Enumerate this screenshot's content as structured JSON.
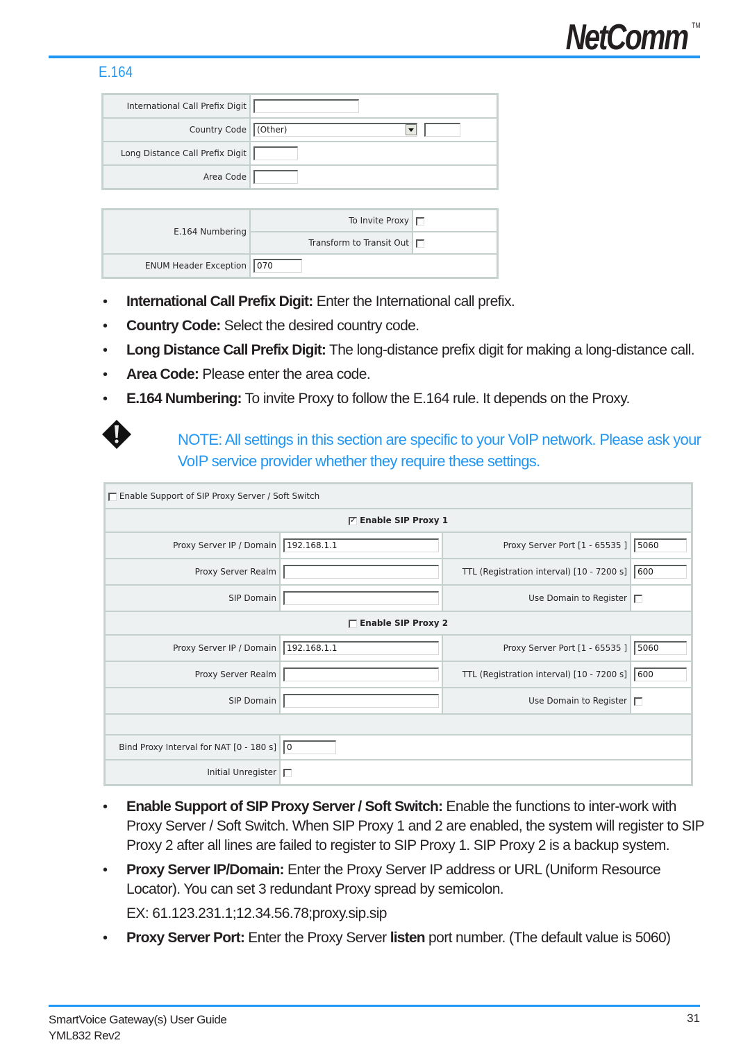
{
  "header": {
    "brand": "NetComm",
    "trademark": "TM",
    "section_title": "E.164",
    "accent_color": "#2196f3"
  },
  "e164_table": {
    "rows": [
      {
        "label": "International Call Prefix Digit",
        "value": ""
      },
      {
        "label": "Country Code",
        "select_value": "(Other)",
        "value": ""
      },
      {
        "label": "Long Distance Call Prefix Digit",
        "value": ""
      },
      {
        "label": "Area Code",
        "value": ""
      }
    ]
  },
  "e164_numbering_table": {
    "group_label": "E.164 Numbering",
    "options": [
      {
        "label": "To Invite Proxy",
        "checked": false
      },
      {
        "label": "Transform to Transit Out",
        "checked": false
      }
    ],
    "enum_label": "ENUM Header Exception",
    "enum_value": "070"
  },
  "bullets_1": [
    {
      "term": "International Call Prefix Digit:",
      "text": " Enter the International call prefix."
    },
    {
      "term": "Country Code:",
      "text": " Select the desired country code."
    },
    {
      "term": "Long Distance Call Prefix Digit:",
      "text": " The long-distance prefix digit for making a long-distance call."
    },
    {
      "term": "Area Code:",
      "text": " Please enter the area code."
    },
    {
      "term": "E.164 Numbering:",
      "text": " To invite Proxy to follow the E.164 rule. It depends on the Proxy."
    }
  ],
  "note": {
    "icon": "warning-diamond-icon",
    "text": "NOTE: All settings in this section are specific to your VoIP network. Please ask your VoIP service provider whether they require these settings."
  },
  "sip_table": {
    "enable_support_label": "Enable Support of SIP Proxy Server / Soft Switch",
    "enable_support_checked": false,
    "proxies": [
      {
        "enable_label": "Enable SIP Proxy 1",
        "enabled": true,
        "ip_label": "Proxy Server IP / Domain",
        "ip_value": "192.168.1.1",
        "port_label": "Proxy Server Port [1 - 65535 ]",
        "port_value": "5060",
        "realm_label": "Proxy Server Realm",
        "realm_value": "",
        "ttl_label": "TTL (Registration interval) [10 - 7200 s]",
        "ttl_value": "600",
        "domain_label": "SIP Domain",
        "domain_value": "",
        "use_domain_label": "Use Domain to Register",
        "use_domain_checked": false
      },
      {
        "enable_label": "Enable SIP Proxy 2",
        "enabled": false,
        "ip_label": "Proxy Server IP / Domain",
        "ip_value": "192.168.1.1",
        "port_label": "Proxy Server Port [1 - 65535 ]",
        "port_value": "5060",
        "realm_label": "Proxy Server Realm",
        "realm_value": "",
        "ttl_label": "TTL (Registration interval) [10 - 7200 s]",
        "ttl_value": "600",
        "domain_label": "SIP Domain",
        "domain_value": "",
        "use_domain_label": "Use Domain to Register",
        "use_domain_checked": false
      }
    ],
    "bind_label": "Bind Proxy Interval for NAT [0 - 180 s]",
    "bind_value": "0",
    "unregister_label": "Initial Unregister",
    "unregister_checked": false
  },
  "bullets_2": [
    {
      "term": "Enable Support of SIP Proxy Server / Soft Switch:",
      "text": " Enable the functions to inter-work with Proxy Server / Soft Switch. When SIP Proxy 1 and 2 are enabled, the system will register to SIP Proxy 2 after all lines are failed to register to SIP Proxy 1. SIP Proxy 2 is a backup system."
    },
    {
      "term": "Proxy Server IP/Domain:",
      "text": " Enter the Proxy Server IP address or URL (Uniform Resource Locator). You can set 3 redundant Proxy spread by semicolon."
    },
    {
      "example": "EX: 61.123.231.1;12.34.56.78;proxy.sip.sip"
    },
    {
      "term": "Proxy Server Port:",
      "text_before": " Enter the Proxy Server ",
      "emphasis": "listen",
      "text_after": " port number. (The default value is 5060)"
    }
  ],
  "footer": {
    "guide_title": "SmartVoice Gateway(s) User Guide",
    "revision": "YML832 Rev2",
    "page_number": "31"
  }
}
